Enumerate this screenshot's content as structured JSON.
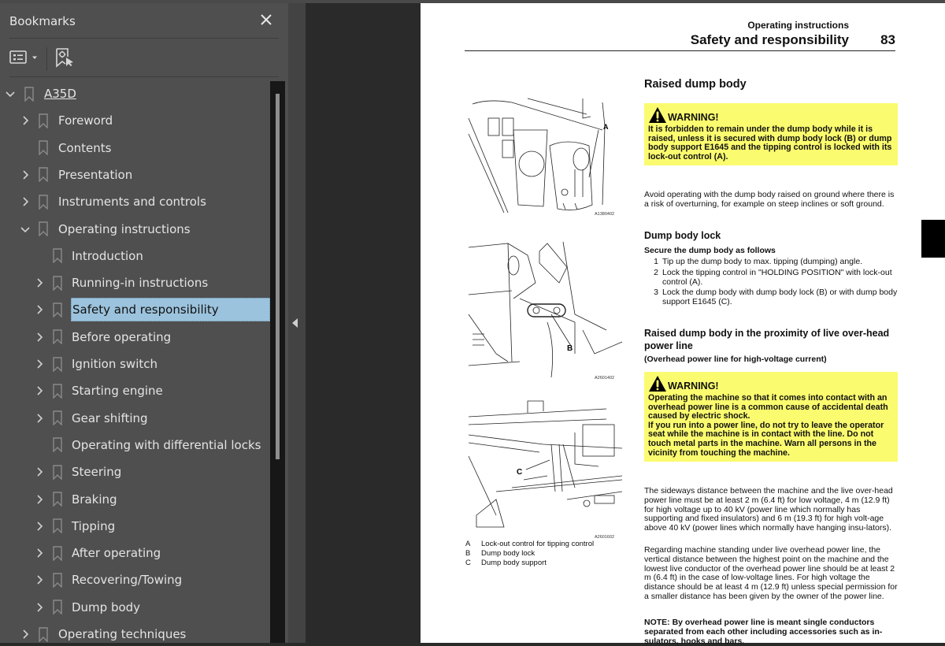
{
  "sidebar": {
    "title": "Bookmarks",
    "close_icon": "close-icon",
    "toolbar": {
      "options_icon": "list-options-icon",
      "find_bookmark_icon": "bookmark-find-icon"
    },
    "items": [
      {
        "label": "A35D",
        "level": 0,
        "expand": "expanded",
        "root": true
      },
      {
        "label": "Foreword",
        "level": 1,
        "expand": "collapsed"
      },
      {
        "label": "Contents",
        "level": 1,
        "expand": "none"
      },
      {
        "label": "Presentation",
        "level": 1,
        "expand": "collapsed"
      },
      {
        "label": "Instruments and controls",
        "level": 1,
        "expand": "collapsed"
      },
      {
        "label": "Operating instructions",
        "level": 1,
        "expand": "expanded"
      },
      {
        "label": "Introduction",
        "level": 2,
        "expand": "none"
      },
      {
        "label": "Running-in instructions",
        "level": 2,
        "expand": "collapsed"
      },
      {
        "label": "Safety and responsibility",
        "level": 2,
        "expand": "collapsed",
        "selected": true
      },
      {
        "label": "Before operating",
        "level": 2,
        "expand": "collapsed"
      },
      {
        "label": "Ignition switch",
        "level": 2,
        "expand": "collapsed"
      },
      {
        "label": "Starting engine",
        "level": 2,
        "expand": "collapsed"
      },
      {
        "label": "Gear shifting",
        "level": 2,
        "expand": "collapsed"
      },
      {
        "label": "Operating with differential locks",
        "level": 2,
        "expand": "none"
      },
      {
        "label": "Steering",
        "level": 2,
        "expand": "collapsed"
      },
      {
        "label": "Braking",
        "level": 2,
        "expand": "collapsed"
      },
      {
        "label": "Tipping",
        "level": 2,
        "expand": "collapsed"
      },
      {
        "label": "After operating",
        "level": 2,
        "expand": "collapsed"
      },
      {
        "label": "Recovering/Towing",
        "level": 2,
        "expand": "collapsed"
      },
      {
        "label": "Dump body",
        "level": 2,
        "expand": "collapsed"
      },
      {
        "label": "Operating techniques",
        "level": 1,
        "expand": "collapsed"
      }
    ],
    "colors": {
      "selected_bg": "#9cc3dd",
      "panel_bg": "#4f4f4f"
    }
  },
  "page": {
    "header_subtitle": "Operating instructions",
    "header_title": "Safety and responsibility",
    "page_number": "83",
    "figures": [
      {
        "code": "A1380402",
        "callout": "A"
      },
      {
        "code": "A2601402",
        "callout": "B"
      },
      {
        "code": "A2601602",
        "callout": "C"
      }
    ],
    "legend": [
      {
        "key": "A",
        "text": "Lock-out control for tipping control"
      },
      {
        "key": "B",
        "text": "Dump body lock"
      },
      {
        "key": "C",
        "text": "Dump body support"
      }
    ],
    "section1_title": "Raised dump body",
    "warning1": {
      "heading": "WARNING!",
      "text": "It is forbidden to remain under the dump body while it is raised, unless it is secured with dump body lock (B) or dump body support E1645 and the tipping control is locked with its lock-out control (A)."
    },
    "para1": "Avoid operating with the dump body raised on ground where there is a risk of overturning, for example on steep inclines or soft ground.",
    "subsection_title": "Dump body lock",
    "steps_intro": "Secure the dump body as follows",
    "steps": [
      {
        "n": "1",
        "text": "Tip up the dump body to max. tipping (dumping) angle."
      },
      {
        "n": "2",
        "text": "Lock the tipping control in \"HOLDING POSITION\" with lock-out control (A)."
      },
      {
        "n": "3",
        "text": "Lock the dump body with dump body lock (B) or with dump body support E1645 (C)."
      }
    ],
    "section2_title": "Raised dump body in the proximity of live over-head power line",
    "section2_subtitle": "(Overhead power line for high-voltage current)",
    "warning2": {
      "heading": "WARNING!",
      "text1": "Operating the machine so that it comes into contact with an overhead power line is a common cause of accidental death caused by electric shock.",
      "text2": "If you run into a power line, do not try to leave the operator seat while the machine is in contact with the line. Do not touch metal parts in the machine. Warn all persons in the vicinity from touching the machine."
    },
    "para2": "The sideways distance between the machine and the live over-head power line must be at least 2 m (6.4 ft) for low voltage, 4 m (12.9 ft) for high voltage up to 40 kV (power line which normally has supporting and fixed insulators) and 6 m (19.3 ft) for high volt-age above 40 kV (power lines which normally have hanging insu-lators).",
    "para3": "Regarding machine standing under live overhead power line, the vertical distance between the highest point on the machine and the lowest live conductor of the overhead power line should be at least 2 m (6.4 ft) in the case of low-voltage lines. For high voltage the distance should be at least 4 m (12.9 ft) unless special permission for a smaller distance has been given by the owner of the power line.",
    "note": "NOTE: By overhead power line is meant single conductors separated from each other including accessories such as in-sulators, hooks and bars.",
    "colors": {
      "warning_bg": "#fbfb6f"
    }
  }
}
